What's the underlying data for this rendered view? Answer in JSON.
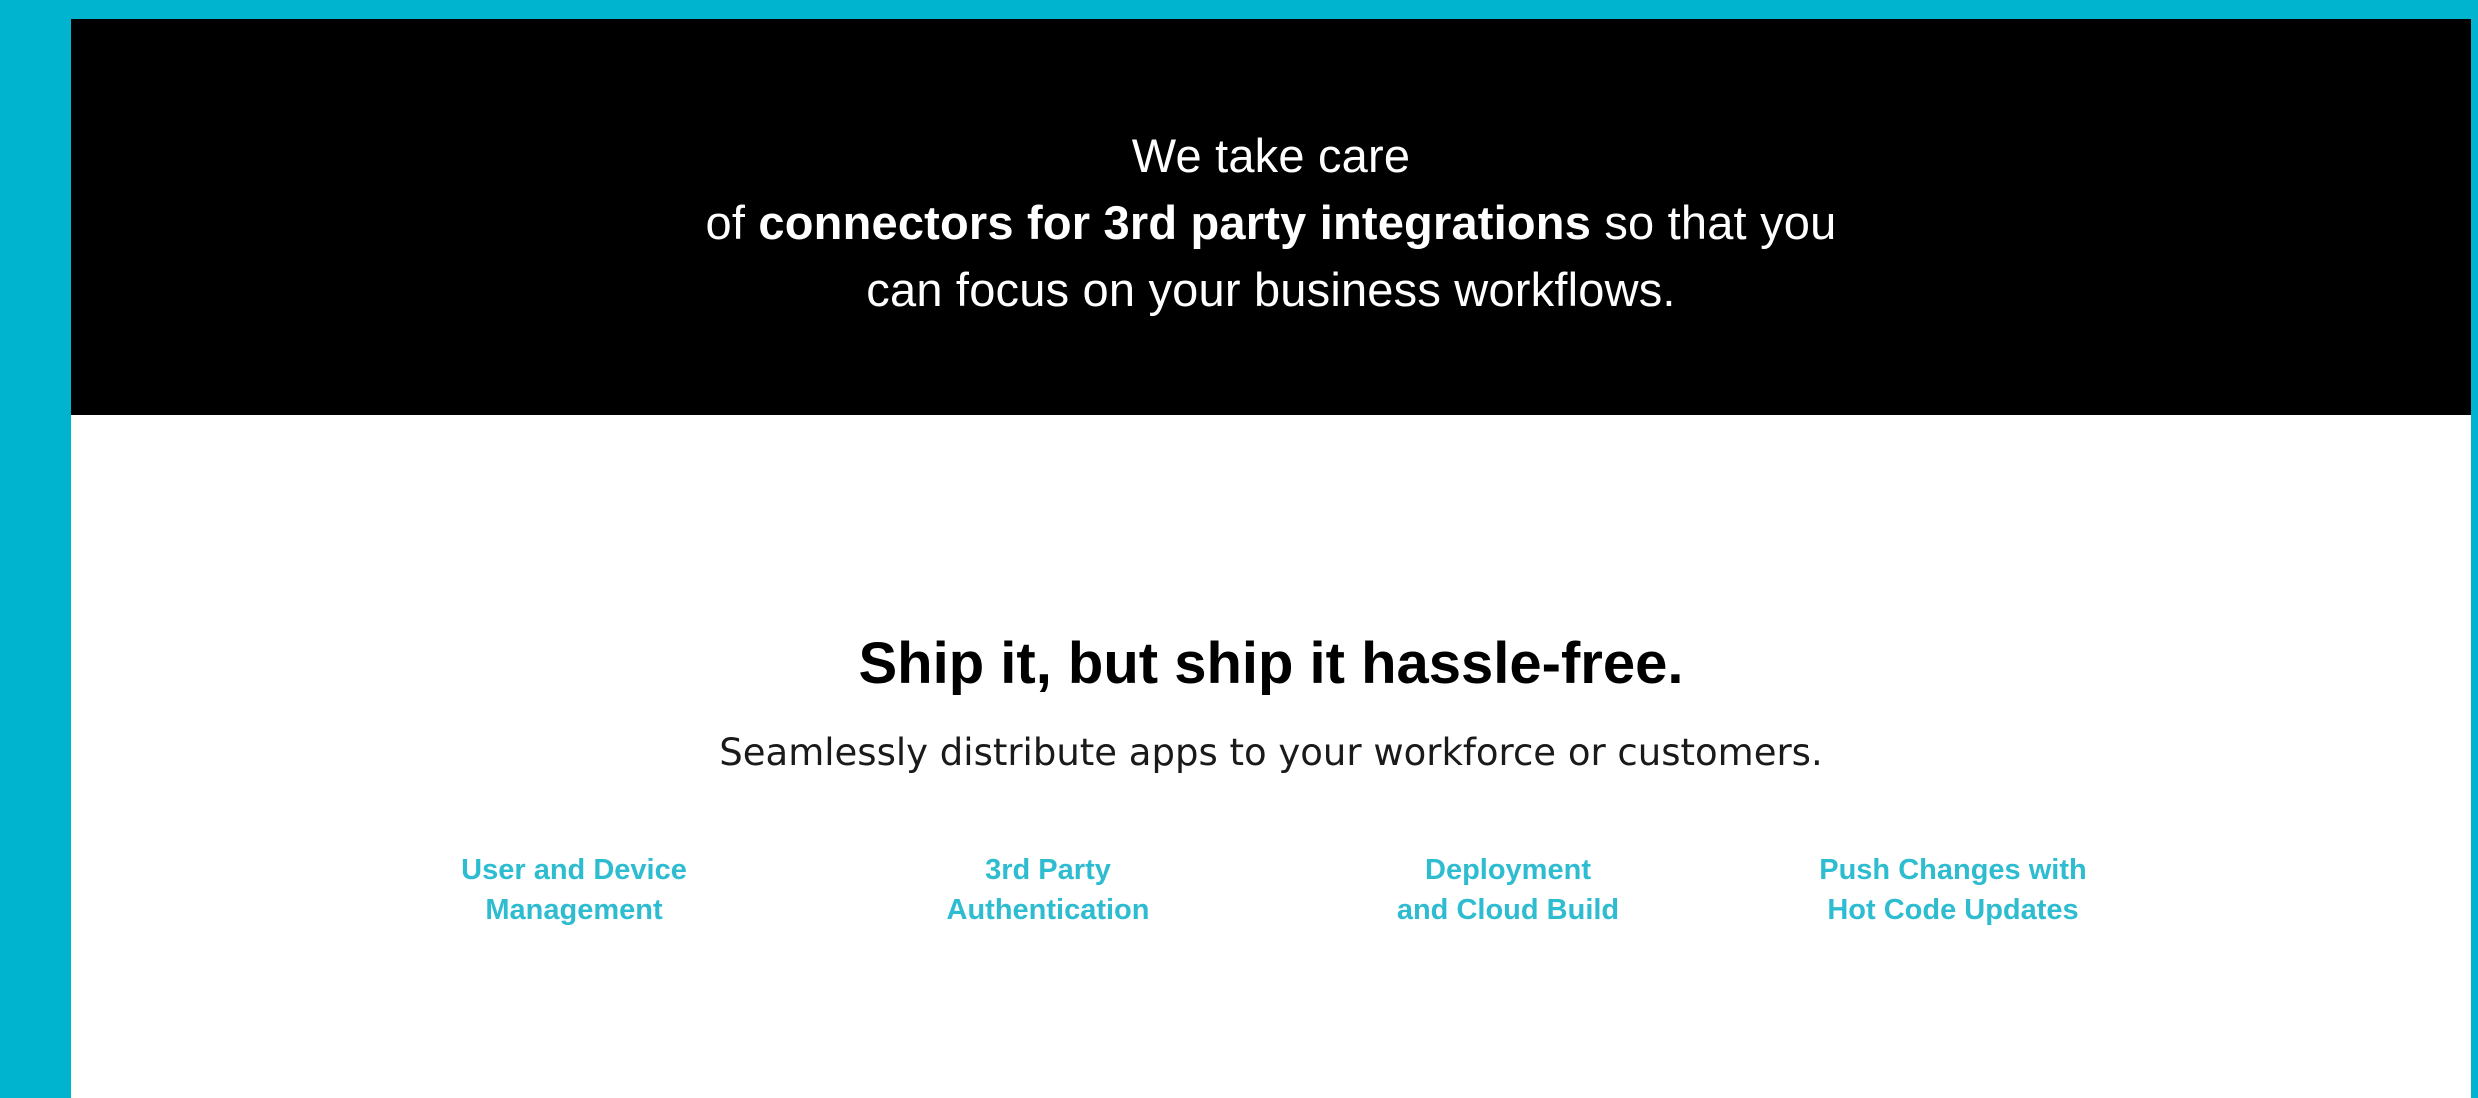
{
  "hero": {
    "line1": "We take care",
    "line2_prefix": "of ",
    "line2_bold": "connectors for 3rd party integrations",
    "line2_suffix": " so that you",
    "line3": "can focus on your business workflows."
  },
  "ship": {
    "title": "Ship it, but ship it hassle-free.",
    "subtitle": "Seamlessly distribute apps to your workforce or customers."
  },
  "features": [
    {
      "line1": "User and Device",
      "line2": "Management"
    },
    {
      "line1": "3rd Party",
      "line2": "Authentication"
    },
    {
      "line1": "Deployment",
      "line2": "and Cloud Build"
    },
    {
      "line1": "Push Changes with",
      "line2": "Hot Code Updates"
    }
  ],
  "colors": {
    "page_border": "#00B4D0",
    "hero_background": "#000000",
    "feature_link": "#2EBCD0"
  }
}
